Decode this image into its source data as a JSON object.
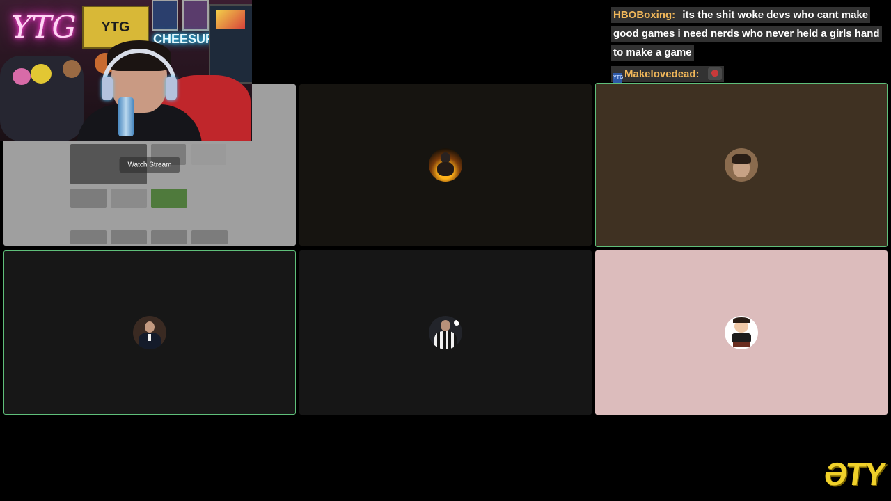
{
  "webcam": {
    "neon_sign": "YTG",
    "banner_text": "YTG",
    "neon_cheesur": "CHEESUR"
  },
  "screenshare": {
    "watch_label": "Watch Stream"
  },
  "tiles": [
    {
      "id": "screenshare",
      "speaking": false
    },
    {
      "id": "user-fire",
      "bg": "#161410",
      "speaking": false
    },
    {
      "id": "user-brown",
      "bg": "#3f3122",
      "speaking": true
    },
    {
      "id": "user-suit",
      "bg": "#171717",
      "speaking": true
    },
    {
      "id": "user-jersey",
      "bg": "#161616",
      "speaking": false
    },
    {
      "id": "user-pink",
      "bg": "#dcbcbc",
      "speaking": false
    }
  ],
  "chat": {
    "messages": [
      {
        "user": "HBOBoxing:",
        "text": "its the shit woke devs who cant make good games i need nerds who never held a girls hand to make a game"
      },
      {
        "user": "Makelovedead:",
        "badge": "YTG",
        "emote": "emote"
      }
    ]
  },
  "logo": {
    "text": "ƏTY"
  },
  "colors": {
    "speaking_border": "#5fbf7a",
    "username": "#f0b75a",
    "logo": "#f0d12a",
    "neon_pink": "#ff3fd3",
    "neon_blue": "#25c8ff"
  }
}
